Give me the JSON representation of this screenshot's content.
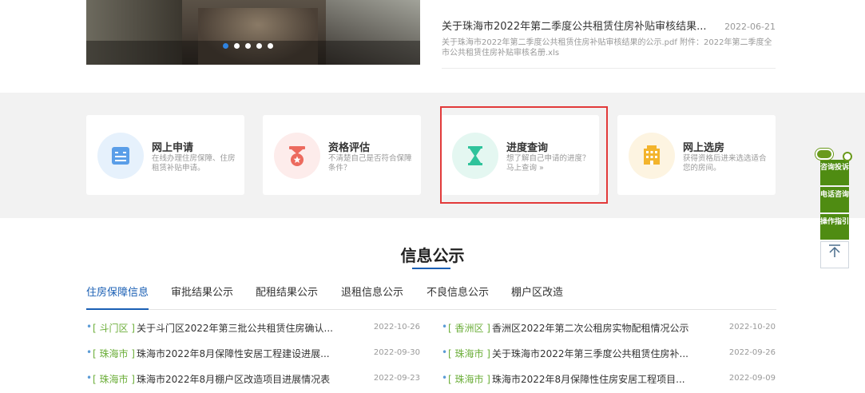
{
  "banner": {
    "dots": 5,
    "active_dot": 0
  },
  "featured_news": {
    "title": "关于珠海市2022年第二季度公共租赁住房补贴审核结果...",
    "date": "2022-06-21",
    "desc": "关于珠海市2022年第二季度公共租赁住房补贴审核结果的公示.pdf 附件：2022年第二季度全市公共租赁住房补贴审核名册.xls"
  },
  "services": [
    {
      "title": "网上申请",
      "desc": "在线办理住房保障、住房租赁补贴申请。",
      "icon": "form-icon",
      "color": "#5a9ee8",
      "bg": "#e6f1fc"
    },
    {
      "title": "资格评估",
      "desc": "不清楚自己是否符合保障条件？",
      "icon": "medal-icon",
      "color": "#ec6a5e",
      "bg": "#fdeceb"
    },
    {
      "title": "进度查询",
      "desc": "想了解自己申请的进度？马上查询 »",
      "icon": "hourglass-icon",
      "color": "#2fc39b",
      "bg": "#e4f7f1"
    },
    {
      "title": "网上选房",
      "desc": "获得资格后进来选选适合您的房间。",
      "icon": "building-icon",
      "color": "#f3b42c",
      "bg": "#fdf4e1"
    }
  ],
  "section": {
    "title": "信息公示"
  },
  "tabs": [
    {
      "label": "住房保障信息",
      "active": true
    },
    {
      "label": "审批结果公示",
      "active": false
    },
    {
      "label": "配租结果公示",
      "active": false
    },
    {
      "label": "退租信息公示",
      "active": false
    },
    {
      "label": "不良信息公示",
      "active": false
    },
    {
      "label": "棚户区改造",
      "active": false
    }
  ],
  "news_left": [
    {
      "tag": "[ 斗门区 ]",
      "title": "关于斗门区2022年第三批公共租赁住房确认...",
      "date": "2022-10-26"
    },
    {
      "tag": "[ 珠海市 ]",
      "title": "珠海市2022年8月保障性安居工程建设进展...",
      "date": "2022-09-30"
    },
    {
      "tag": "[ 珠海市 ]",
      "title": "珠海市2022年8月棚户区改造项目进展情况表",
      "date": "2022-09-23"
    }
  ],
  "news_right": [
    {
      "tag": "[ 香洲区 ]",
      "title": "香洲区2022年第二次公租房实物配租情况公示",
      "date": "2022-10-20"
    },
    {
      "tag": "[ 珠海市 ]",
      "title": "关于珠海市2022年第三季度公共租赁住房补...",
      "date": "2022-09-26"
    },
    {
      "tag": "[ 珠海市 ]",
      "title": "珠海市2022年8月保障性住房安居工程项目...",
      "date": "2022-09-09"
    }
  ],
  "float_bar": {
    "items": [
      {
        "label": "咨询投诉"
      },
      {
        "label": "电话咨询"
      },
      {
        "label": "操作指引"
      }
    ],
    "top_icon": "⌅"
  }
}
